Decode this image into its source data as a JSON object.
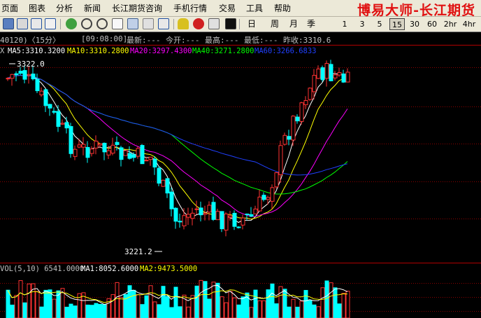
{
  "menu": {
    "items": [
      {
        "label": "页面"
      },
      {
        "label": "图表"
      },
      {
        "label": "分析"
      },
      {
        "label": "新闻"
      },
      {
        "label": "长江期货咨询"
      },
      {
        "label": "手机行情"
      },
      {
        "label": "交易"
      },
      {
        "label": "工具"
      },
      {
        "label": "帮助"
      }
    ],
    "brand": "博易大师-长江期货"
  },
  "toolbar": {
    "periods": [
      "日",
      "周",
      "月",
      "季",
      "1",
      "3",
      "5",
      "15",
      "30",
      "60",
      "2hr",
      "4hr"
    ],
    "active_period": "15"
  },
  "info": {
    "contract": "40120)〈15分〉",
    "time": "[09:08:00]",
    "latest": "最新:---",
    "open": "今开:---",
    "high": "最高:---",
    "low": "最低:---",
    "prev_close": "昨收:3310.6"
  },
  "ma": {
    "prefix": "X",
    "ma5": "MA5:3310.3200",
    "ma10": "MA10:3310.2800",
    "ma20": "MA20:3297.4300",
    "ma40": "MA40:3271.2800",
    "ma60": "MA60:3266.6833",
    "colors": {
      "ma5": "#ffffff",
      "ma10": "#ffff00",
      "ma20": "#ff00ff",
      "ma40": "#00ff00",
      "ma60": "#2040ff"
    }
  },
  "price_labels": {
    "high": "3322.0",
    "low": "3221.2"
  },
  "vol": {
    "label": "VOL(5,10) 6541.0000",
    "ma1": "MA1:8052.6000",
    "ma2": "MA2:9473.5000"
  },
  "colors": {
    "up": "#ff3232",
    "down": "#00ffff",
    "grid": "#8b0000"
  }
}
